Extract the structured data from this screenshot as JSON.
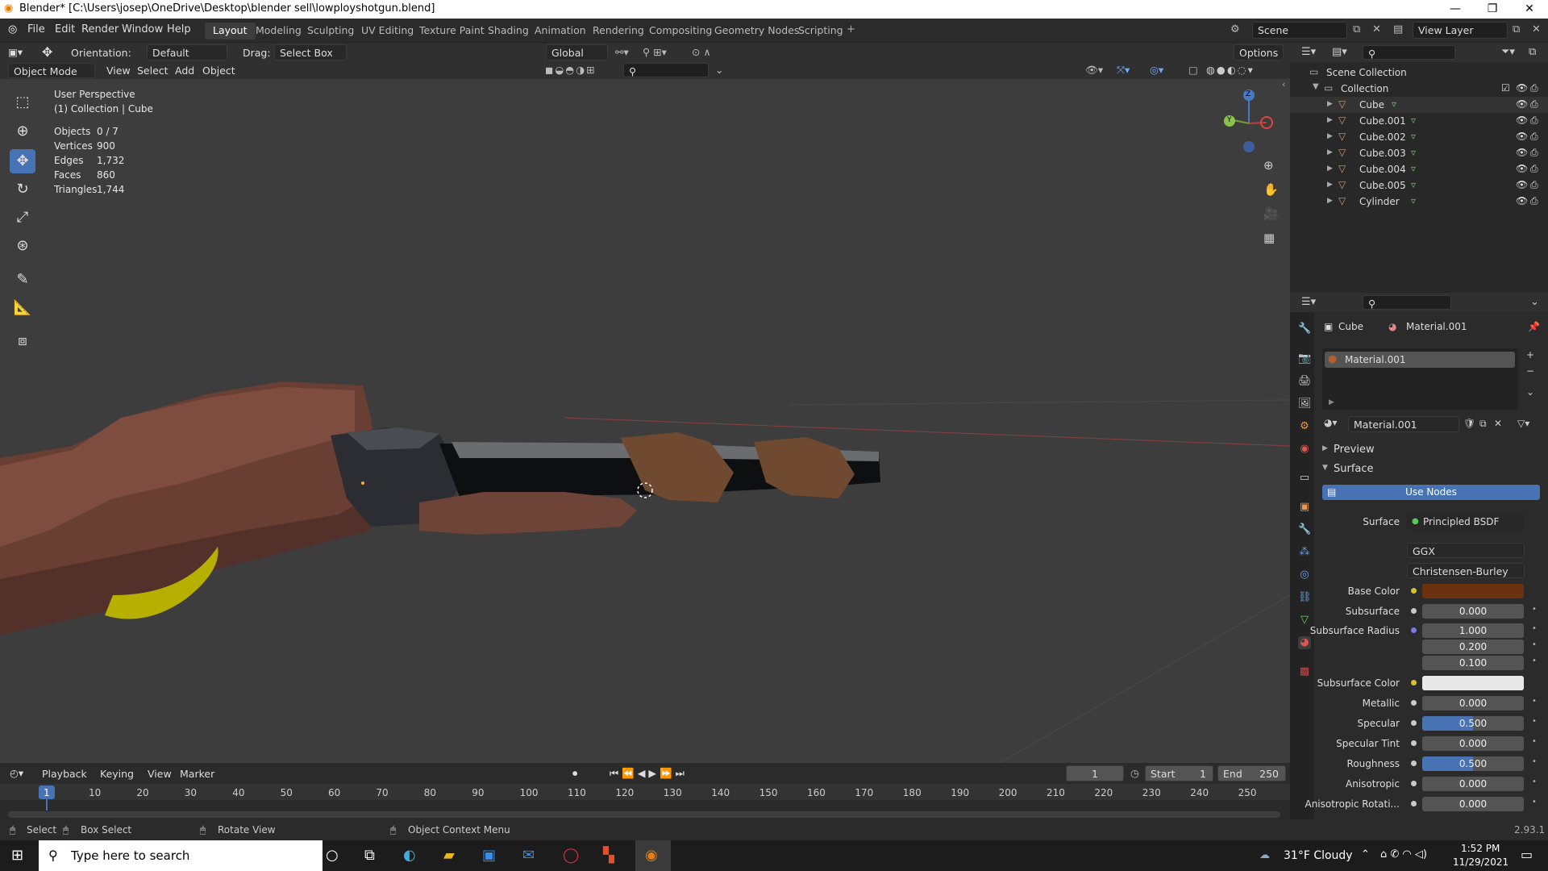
{
  "window": {
    "title": "Blender* [C:\\Users\\josep\\OneDrive\\Desktop\\blender sell\\lowployshotgun.blend]",
    "min": "—",
    "max": "❐",
    "close": "✕"
  },
  "menu": [
    "File",
    "Edit",
    "Render",
    "Window",
    "Help"
  ],
  "workspaces": [
    "Layout",
    "Modeling",
    "Sculpting",
    "UV Editing",
    "Texture Paint",
    "Shading",
    "Animation",
    "Rendering",
    "Compositing",
    "Geometry Nodes",
    "Scripting"
  ],
  "scene": "Scene",
  "view_layer": "View Layer",
  "header": {
    "orientation_label": "Orientation:",
    "orientation_value": "Default",
    "drag_label": "Drag:",
    "drag_value": "Select Box",
    "transform_space": "Global",
    "options": "Options"
  },
  "viewport_header": {
    "mode": "Object Mode",
    "view": "View",
    "select": "Select",
    "add": "Add",
    "object": "Object"
  },
  "overlay": {
    "perspective": "User Perspective",
    "collection": "(1) Collection | Cube"
  },
  "stats": [
    {
      "label": "Objects",
      "value": "0 / 7"
    },
    {
      "label": "Vertices",
      "value": "900"
    },
    {
      "label": "Edges",
      "value": "1,732"
    },
    {
      "label": "Faces",
      "value": "860"
    },
    {
      "label": "Triangles",
      "value": "1,744"
    }
  ],
  "gizmo": {
    "z": "Z",
    "y": "Y"
  },
  "outliner": {
    "scene_collection": "Scene Collection",
    "collection": "Collection",
    "objects": [
      "Cube",
      "Cube.001",
      "Cube.002",
      "Cube.003",
      "Cube.004",
      "Cube.005",
      "Cylinder"
    ]
  },
  "properties": {
    "breadcrumb_object": "Cube",
    "breadcrumb_material": "Material.001",
    "slot": "Material.001",
    "material_name": "Material.001",
    "preview": "Preview",
    "surface_panel": "Surface",
    "use_nodes": "Use Nodes",
    "surface_label": "Surface",
    "surface_value": "Principled BSDF",
    "distribution": "GGX",
    "subsurface_method": "Christensen-Burley",
    "base_color_label": "Base Color",
    "base_color": "#6b3210",
    "rows": [
      {
        "label": "Subsurface",
        "value": "0.000"
      },
      {
        "label": "Subsurface Radius",
        "value": "1.000"
      },
      {
        "label": "",
        "value": "0.200"
      },
      {
        "label": "",
        "value": "0.100"
      }
    ],
    "subsurface_color_label": "Subsurface Color",
    "subsurface_color": "#e8e8e8",
    "rows2": [
      {
        "label": "Metallic",
        "value": "0.000",
        "fill": 0
      },
      {
        "label": "Specular",
        "value": "0.500",
        "fill": 0.5
      },
      {
        "label": "Specular Tint",
        "value": "0.000",
        "fill": 0
      },
      {
        "label": "Roughness",
        "value": "0.500",
        "fill": 0.5
      },
      {
        "label": "Anisotropic",
        "value": "0.000",
        "fill": 0
      },
      {
        "label": "Anisotropic Rotati...",
        "value": "0.000",
        "fill": 0
      }
    ]
  },
  "timeline": {
    "playback": "Playback",
    "keying": "Keying",
    "view": "View",
    "marker": "Marker",
    "current_frame": "1",
    "start_label": "Start",
    "start": "1",
    "end_label": "End",
    "end": "250",
    "ticks": [
      "1",
      "10",
      "20",
      "30",
      "40",
      "50",
      "60",
      "70",
      "80",
      "90",
      "100",
      "110",
      "120",
      "130",
      "140",
      "150",
      "160",
      "170",
      "180",
      "190",
      "200",
      "210",
      "220",
      "230",
      "240",
      "250"
    ]
  },
  "status": {
    "select": "Select",
    "box_select": "Box Select",
    "rotate_view": "Rotate View",
    "context_menu": "Object Context Menu",
    "version": "2.93.1"
  },
  "taskbar": {
    "search_placeholder": "Type here to search",
    "weather": "31°F  Cloudy",
    "time": "1:52 PM",
    "date": "11/29/2021"
  }
}
